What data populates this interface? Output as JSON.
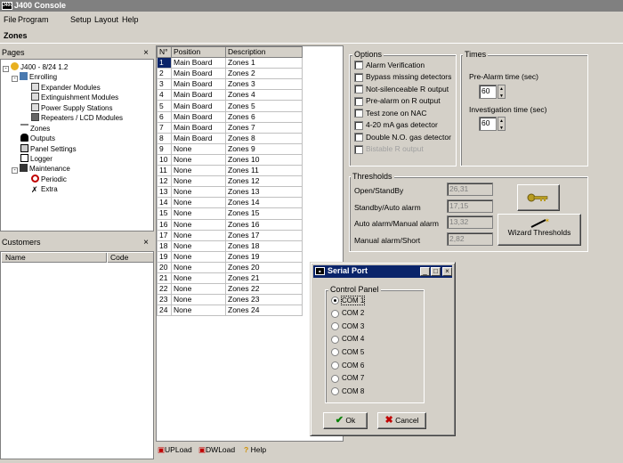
{
  "window": {
    "title": "J400 Console",
    "icon_text": "J400"
  },
  "menu": [
    "File",
    "Program",
    "Setup",
    "Layout",
    "Help"
  ],
  "page_title": "Zones",
  "pages_panel": {
    "title": "Pages",
    "tree": [
      "J400 - 8/24 1.2",
      "Enrolling",
      "Expander Modules",
      "Extinguishment Modules",
      "Power Supply Stations",
      "Repeaters / LCD Modules",
      "Zones",
      "Outputs",
      "Panel Settings",
      "Logger",
      "Maintenance",
      "Periodic",
      "Extra"
    ]
  },
  "customers_panel": {
    "title": "Customers",
    "col_name": "Name",
    "col_code": "Code"
  },
  "grid": {
    "headers": [
      "N°",
      "Position",
      "Description"
    ],
    "rows": [
      [
        "1",
        "Main Board",
        "Zones 1"
      ],
      [
        "2",
        "Main Board",
        "Zones 2"
      ],
      [
        "3",
        "Main Board",
        "Zones 3"
      ],
      [
        "4",
        "Main Board",
        "Zones 4"
      ],
      [
        "5",
        "Main Board",
        "Zones 5"
      ],
      [
        "6",
        "Main Board",
        "Zones 6"
      ],
      [
        "7",
        "Main Board",
        "Zones 7"
      ],
      [
        "8",
        "Main Board",
        "Zones 8"
      ],
      [
        "9",
        "None",
        "Zones 9"
      ],
      [
        "10",
        "None",
        "Zones 10"
      ],
      [
        "11",
        "None",
        "Zones 11"
      ],
      [
        "12",
        "None",
        "Zones 12"
      ],
      [
        "13",
        "None",
        "Zones 13"
      ],
      [
        "14",
        "None",
        "Zones 14"
      ],
      [
        "15",
        "None",
        "Zones 15"
      ],
      [
        "16",
        "None",
        "Zones 16"
      ],
      [
        "17",
        "None",
        "Zones 17"
      ],
      [
        "18",
        "None",
        "Zones 18"
      ],
      [
        "19",
        "None",
        "Zones 19"
      ],
      [
        "20",
        "None",
        "Zones 20"
      ],
      [
        "21",
        "None",
        "Zones 21"
      ],
      [
        "22",
        "None",
        "Zones 22"
      ],
      [
        "23",
        "None",
        "Zones 23"
      ],
      [
        "24",
        "None",
        "Zones 24"
      ]
    ]
  },
  "bottom_bar": {
    "upload": "UPLoad",
    "dwload": "DWLoad",
    "help": "Help"
  },
  "options": {
    "title": "Options",
    "items": [
      "Alarm Verification",
      "Bypass missing detectors",
      "Not-silenceable R output",
      "Pre-alarm on R output",
      "Test zone on NAC",
      "4-20 mA gas detector",
      "Double N.O. gas detector",
      "Bistable R output"
    ]
  },
  "times": {
    "title": "Times",
    "prealarm_label": "Pre-Alarm time (sec)",
    "prealarm_value": "60",
    "investigation_label": "Investigation time (sec)",
    "investigation_value": "60"
  },
  "thresholds": {
    "title": "Thresholds",
    "rows": [
      {
        "label": "Open/StandBy",
        "value": "26,31"
      },
      {
        "label": "Standby/Auto alarm",
        "value": "17,15"
      },
      {
        "label": "Auto alarm/Manual alarm",
        "value": "13,32"
      },
      {
        "label": "Manual alarm/Short",
        "value": "2,82"
      }
    ],
    "wizard_label": "Wizard Thresholds"
  },
  "serial_dialog": {
    "title": "Serial Port",
    "group_label": "Control Panel",
    "ports": [
      "COM 1",
      "COM 2",
      "COM 3",
      "COM 4",
      "COM 5",
      "COM 6",
      "COM 7",
      "COM 8"
    ],
    "selected_index": 0,
    "ok_label": "Ok",
    "cancel_label": "Cancel"
  }
}
